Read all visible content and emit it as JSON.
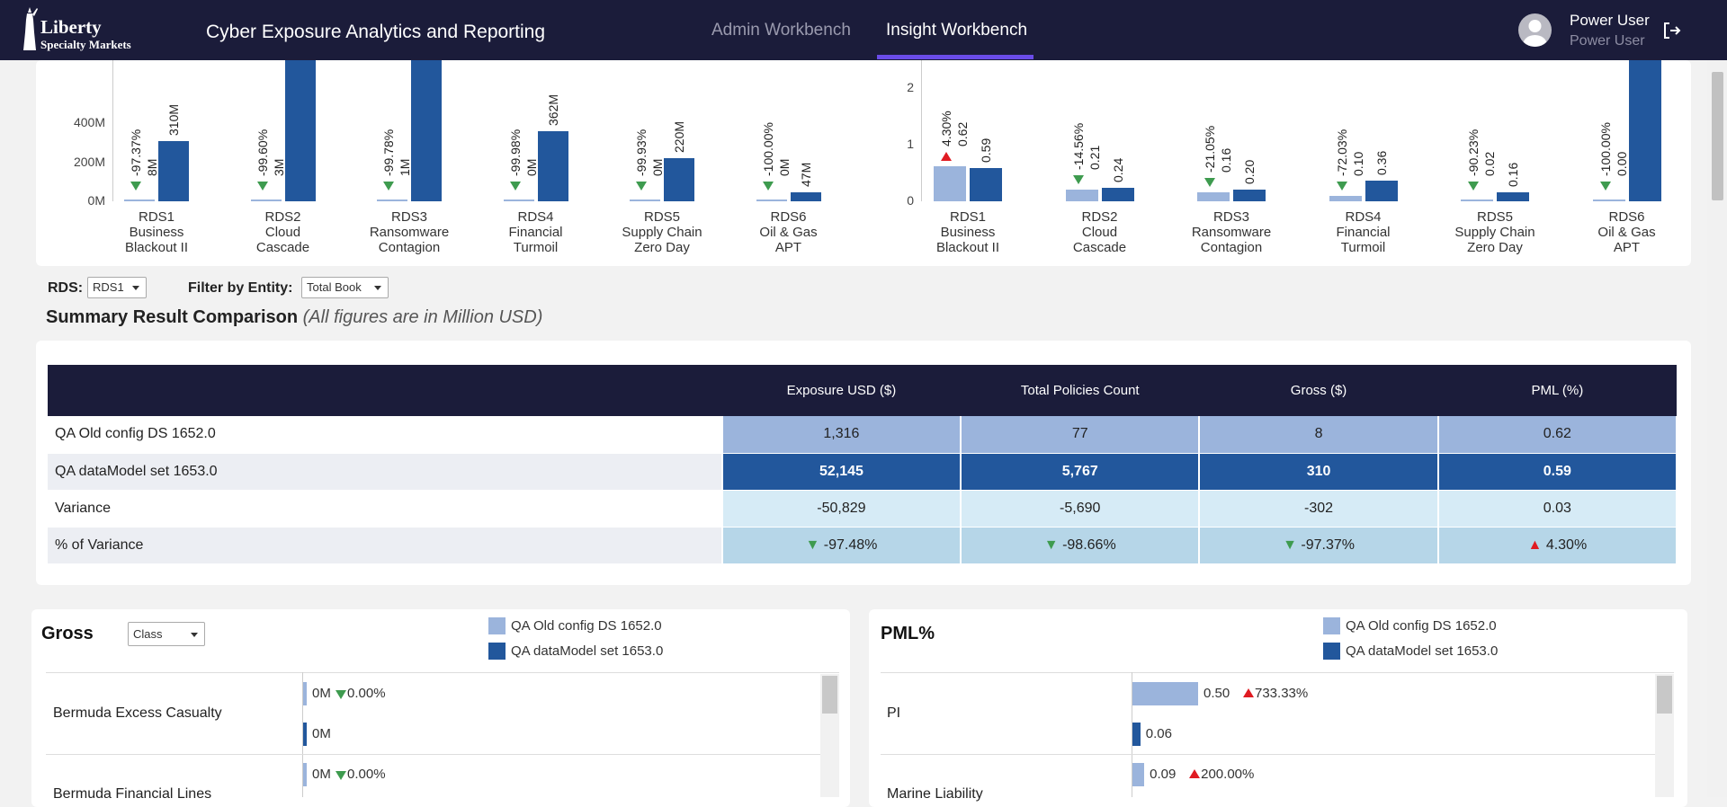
{
  "header": {
    "logo_line1": "Liberty",
    "logo_line2": "Specialty Markets",
    "app_title": "Cyber Exposure Analytics and Reporting",
    "tabs": [
      {
        "label": "Admin Workbench",
        "active": false
      },
      {
        "label": "Insight Workbench",
        "active": true
      }
    ],
    "user_name": "Power User",
    "user_role": "Power User",
    "accent_color": "#6a4ce8"
  },
  "chart_data": [
    {
      "type": "bar",
      "categories": [
        "RDS1 Business Blackout II",
        "RDS2 Cloud Cascade",
        "RDS3 Ransomware Contagion",
        "RDS4 Financial Turmoil",
        "RDS5 Supply Chain Zero Day",
        "RDS6 Oil & Gas APT"
      ],
      "category_lines": [
        [
          "RDS1",
          "Business",
          "Blackout II"
        ],
        [
          "RDS2",
          "Cloud",
          "Cascade"
        ],
        [
          "RDS3",
          "Ransomware",
          "Contagion"
        ],
        [
          "RDS4",
          "Financial",
          "Turmoil"
        ],
        [
          "RDS5",
          "Supply Chain",
          "Zero Day"
        ],
        [
          "RDS6",
          "Oil & Gas",
          "APT"
        ]
      ],
      "y_ticks": [
        "0M",
        "200M",
        "400M"
      ],
      "ylim": [
        0,
        400
      ],
      "series": [
        {
          "name": "QA Old config DS 1652.0",
          "values": [
            8,
            3,
            1,
            0,
            0,
            0
          ],
          "labels": [
            "8M",
            "3M",
            "1M",
            "0M",
            "0M",
            "0M"
          ],
          "color": "#9bb4dc"
        },
        {
          "name": "QA dataModel set 1653.0",
          "values": [
            310,
            1100,
            1100,
            362,
            220,
            47
          ],
          "labels": [
            "310M",
            "",
            "",
            "362M",
            "220M",
            "47M"
          ],
          "color": "#22579c"
        }
      ],
      "variance": [
        "-97.37%",
        "-99.60%",
        "-99.78%",
        "-99.98%",
        "-99.93%",
        "-100.00%"
      ],
      "variance_dir": [
        "down",
        "down",
        "down",
        "down",
        "down",
        "down"
      ]
    },
    {
      "type": "bar",
      "categories": [
        "RDS1 Business Blackout II",
        "RDS2 Cloud Cascade",
        "RDS3 Ransomware Contagion",
        "RDS4 Financial Turmoil",
        "RDS5 Supply Chain Zero Day",
        "RDS6 Oil & Gas APT"
      ],
      "category_lines": [
        [
          "RDS1",
          "Business",
          "Blackout II"
        ],
        [
          "RDS2",
          "Cloud",
          "Cascade"
        ],
        [
          "RDS3",
          "Ransomware",
          "Contagion"
        ],
        [
          "RDS4",
          "Financial",
          "Turmoil"
        ],
        [
          "RDS5",
          "Supply Chain",
          "Zero Day"
        ],
        [
          "RDS6",
          "Oil & Gas",
          "APT"
        ]
      ],
      "y_ticks": [
        "0",
        "1",
        "2"
      ],
      "ylim": [
        0,
        2
      ],
      "series": [
        {
          "name": "QA Old config DS 1652.0",
          "values": [
            0.62,
            0.21,
            0.16,
            0.1,
            0.02,
            0.0
          ],
          "labels": [
            "0.62",
            "0.21",
            "0.16",
            "0.10",
            "0.02",
            "0.00"
          ],
          "color": "#9bb4dc"
        },
        {
          "name": "QA dataModel set 1653.0",
          "values": [
            0.59,
            0.24,
            0.2,
            0.36,
            0.16,
            3.5
          ],
          "labels": [
            "0.59",
            "0.24",
            "0.20",
            "0.36",
            "0.16",
            ""
          ],
          "color": "#22579c"
        }
      ],
      "variance": [
        "4.30%",
        "-14.56%",
        "-21.05%",
        "-72.03%",
        "-90.23%",
        "-100.00%"
      ],
      "variance_dir": [
        "up",
        "down",
        "down",
        "down",
        "down",
        "down"
      ]
    },
    {
      "type": "bar",
      "title": "Gross",
      "categories": [
        "Bermuda Excess Casualty",
        "Bermuda Financial Lines"
      ],
      "series": [
        {
          "name": "QA Old config DS 1652.0",
          "values": [
            0,
            0
          ],
          "labels": [
            "0M",
            "0M"
          ]
        },
        {
          "name": "QA dataModel set 1653.0",
          "values": [
            0,
            null
          ],
          "labels": [
            "0M",
            ""
          ]
        }
      ],
      "variance": [
        "0.00%",
        "0.00%"
      ],
      "variance_dir": [
        "down",
        "down"
      ]
    },
    {
      "type": "bar",
      "title": "PML%",
      "categories": [
        "PI",
        "Marine Liability"
      ],
      "series": [
        {
          "name": "QA Old config DS 1652.0",
          "values": [
            0.5,
            0.09
          ],
          "labels": [
            "0.50",
            "0.09"
          ]
        },
        {
          "name": "QA dataModel set 1653.0",
          "values": [
            0.06,
            null
          ],
          "labels": [
            "0.06",
            ""
          ]
        }
      ],
      "variance": [
        "733.33%",
        "200.00%"
      ],
      "variance_dir": [
        "up",
        "up"
      ]
    }
  ],
  "filters": {
    "rds_label": "RDS:",
    "rds_value": "RDS1",
    "entity_label": "Filter by Entity:",
    "entity_value": "Total Book"
  },
  "summary": {
    "title": "Summary Result Comparison",
    "subtitle": "(All figures are in Million USD)",
    "columns": [
      "Exposure USD ($)",
      "Total Policies Count",
      "Gross ($)",
      "PML (%)"
    ],
    "rows": [
      {
        "label": "QA Old config DS 1652.0",
        "cells": [
          "1,316",
          "77",
          "8",
          "0.62"
        ]
      },
      {
        "label": "QA dataModel set 1653.0",
        "cells": [
          "52,145",
          "5,767",
          "310",
          "0.59"
        ]
      },
      {
        "label": "Variance",
        "cells": [
          "-50,829",
          "-5,690",
          "-302",
          "0.03"
        ]
      },
      {
        "label": "% of Variance",
        "cells": [
          "-97.48%",
          "-98.66%",
          "-97.37%",
          "4.30%"
        ],
        "dirs": [
          "down",
          "down",
          "down",
          "up"
        ]
      }
    ]
  },
  "gross_panel": {
    "title": "Gross",
    "dropdown_value": "Class",
    "legend": [
      "QA Old config DS 1652.0",
      "QA dataModel set 1653.0"
    ]
  },
  "pml_panel": {
    "title": "PML%",
    "legend": [
      "QA Old config DS 1652.0",
      "QA dataModel set 1653.0"
    ]
  },
  "colors": {
    "navy": "#1b1c3a",
    "light_bar": "#9bb4dc",
    "dark_bar": "#22579c",
    "up_red": "#e01b22",
    "down_green": "#3e9b4f"
  }
}
